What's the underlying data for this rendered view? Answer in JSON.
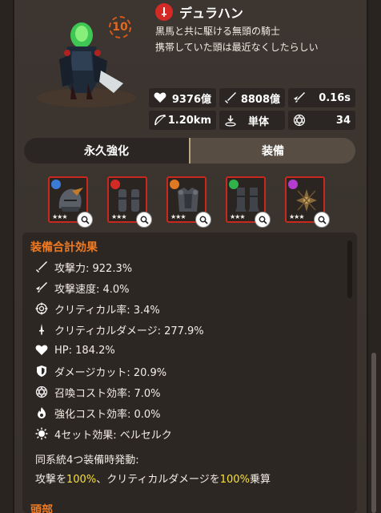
{
  "character": {
    "name": "デュラハン",
    "level": "10",
    "description_line1": "黒馬と共に駆ける無頭の騎士",
    "description_line2": "携帯していた頭は最近なくしたらしい",
    "attribute_icon": "sword-icon",
    "attribute_color": "#d42a26"
  },
  "stats": {
    "hp": "9376億",
    "attack": "8808億",
    "attack_speed": "0.16s",
    "range": "1.20km",
    "target_type": "単体",
    "cost": "34"
  },
  "tabs": [
    {
      "label": "永久強化",
      "active": false
    },
    {
      "label": "装備",
      "active": true
    }
  ],
  "equipment": [
    {
      "name": "helmet",
      "type_color": "#3a7bd5",
      "stars": "★★★"
    },
    {
      "name": "gauntlets",
      "type_color": "#d42a26",
      "stars": "★★★"
    },
    {
      "name": "armor",
      "type_color": "#e07a22",
      "stars": "★★★"
    },
    {
      "name": "boots",
      "type_color": "#2fb34a",
      "stars": "★★★"
    },
    {
      "name": "amulet",
      "type_color": "#b43ad0",
      "stars": "★★★"
    }
  ],
  "effects": {
    "title": "装備合計効果",
    "rows": [
      {
        "icon": "sword-icon",
        "label": "攻撃力: 922.3%"
      },
      {
        "icon": "winged-sword-icon",
        "label": "攻撃速度: 4.0%"
      },
      {
        "icon": "crosshair-icon",
        "label": "クリティカル率: 3.4%"
      },
      {
        "icon": "dagger-icon",
        "label": "クリティカルダメージ: 277.9%"
      },
      {
        "icon": "heart-icon",
        "label": "HP: 184.2%"
      },
      {
        "icon": "shield-icon",
        "label": "ダメージカット: 20.9%"
      },
      {
        "icon": "summon-icon",
        "label": "召喚コスト効率: 7.0%"
      },
      {
        "icon": "flame-icon",
        "label": "強化コスト効率: 0.0%"
      },
      {
        "icon": "berserk-icon",
        "label": "4セット効果: ベルセルク"
      }
    ],
    "set_condition": "同系統4つ装備時発動:",
    "set_desc_prefix": "攻撃を",
    "set_value1": "100%",
    "set_desc_middle": "、クリティカルダメージを",
    "set_value2": "100%",
    "set_desc_suffix": "乗算",
    "next_section": "頭部"
  },
  "colors": {
    "accent_orange": "#f07a22",
    "highlight_yellow": "#f7e030",
    "slot_border_red": "#c8281d"
  }
}
